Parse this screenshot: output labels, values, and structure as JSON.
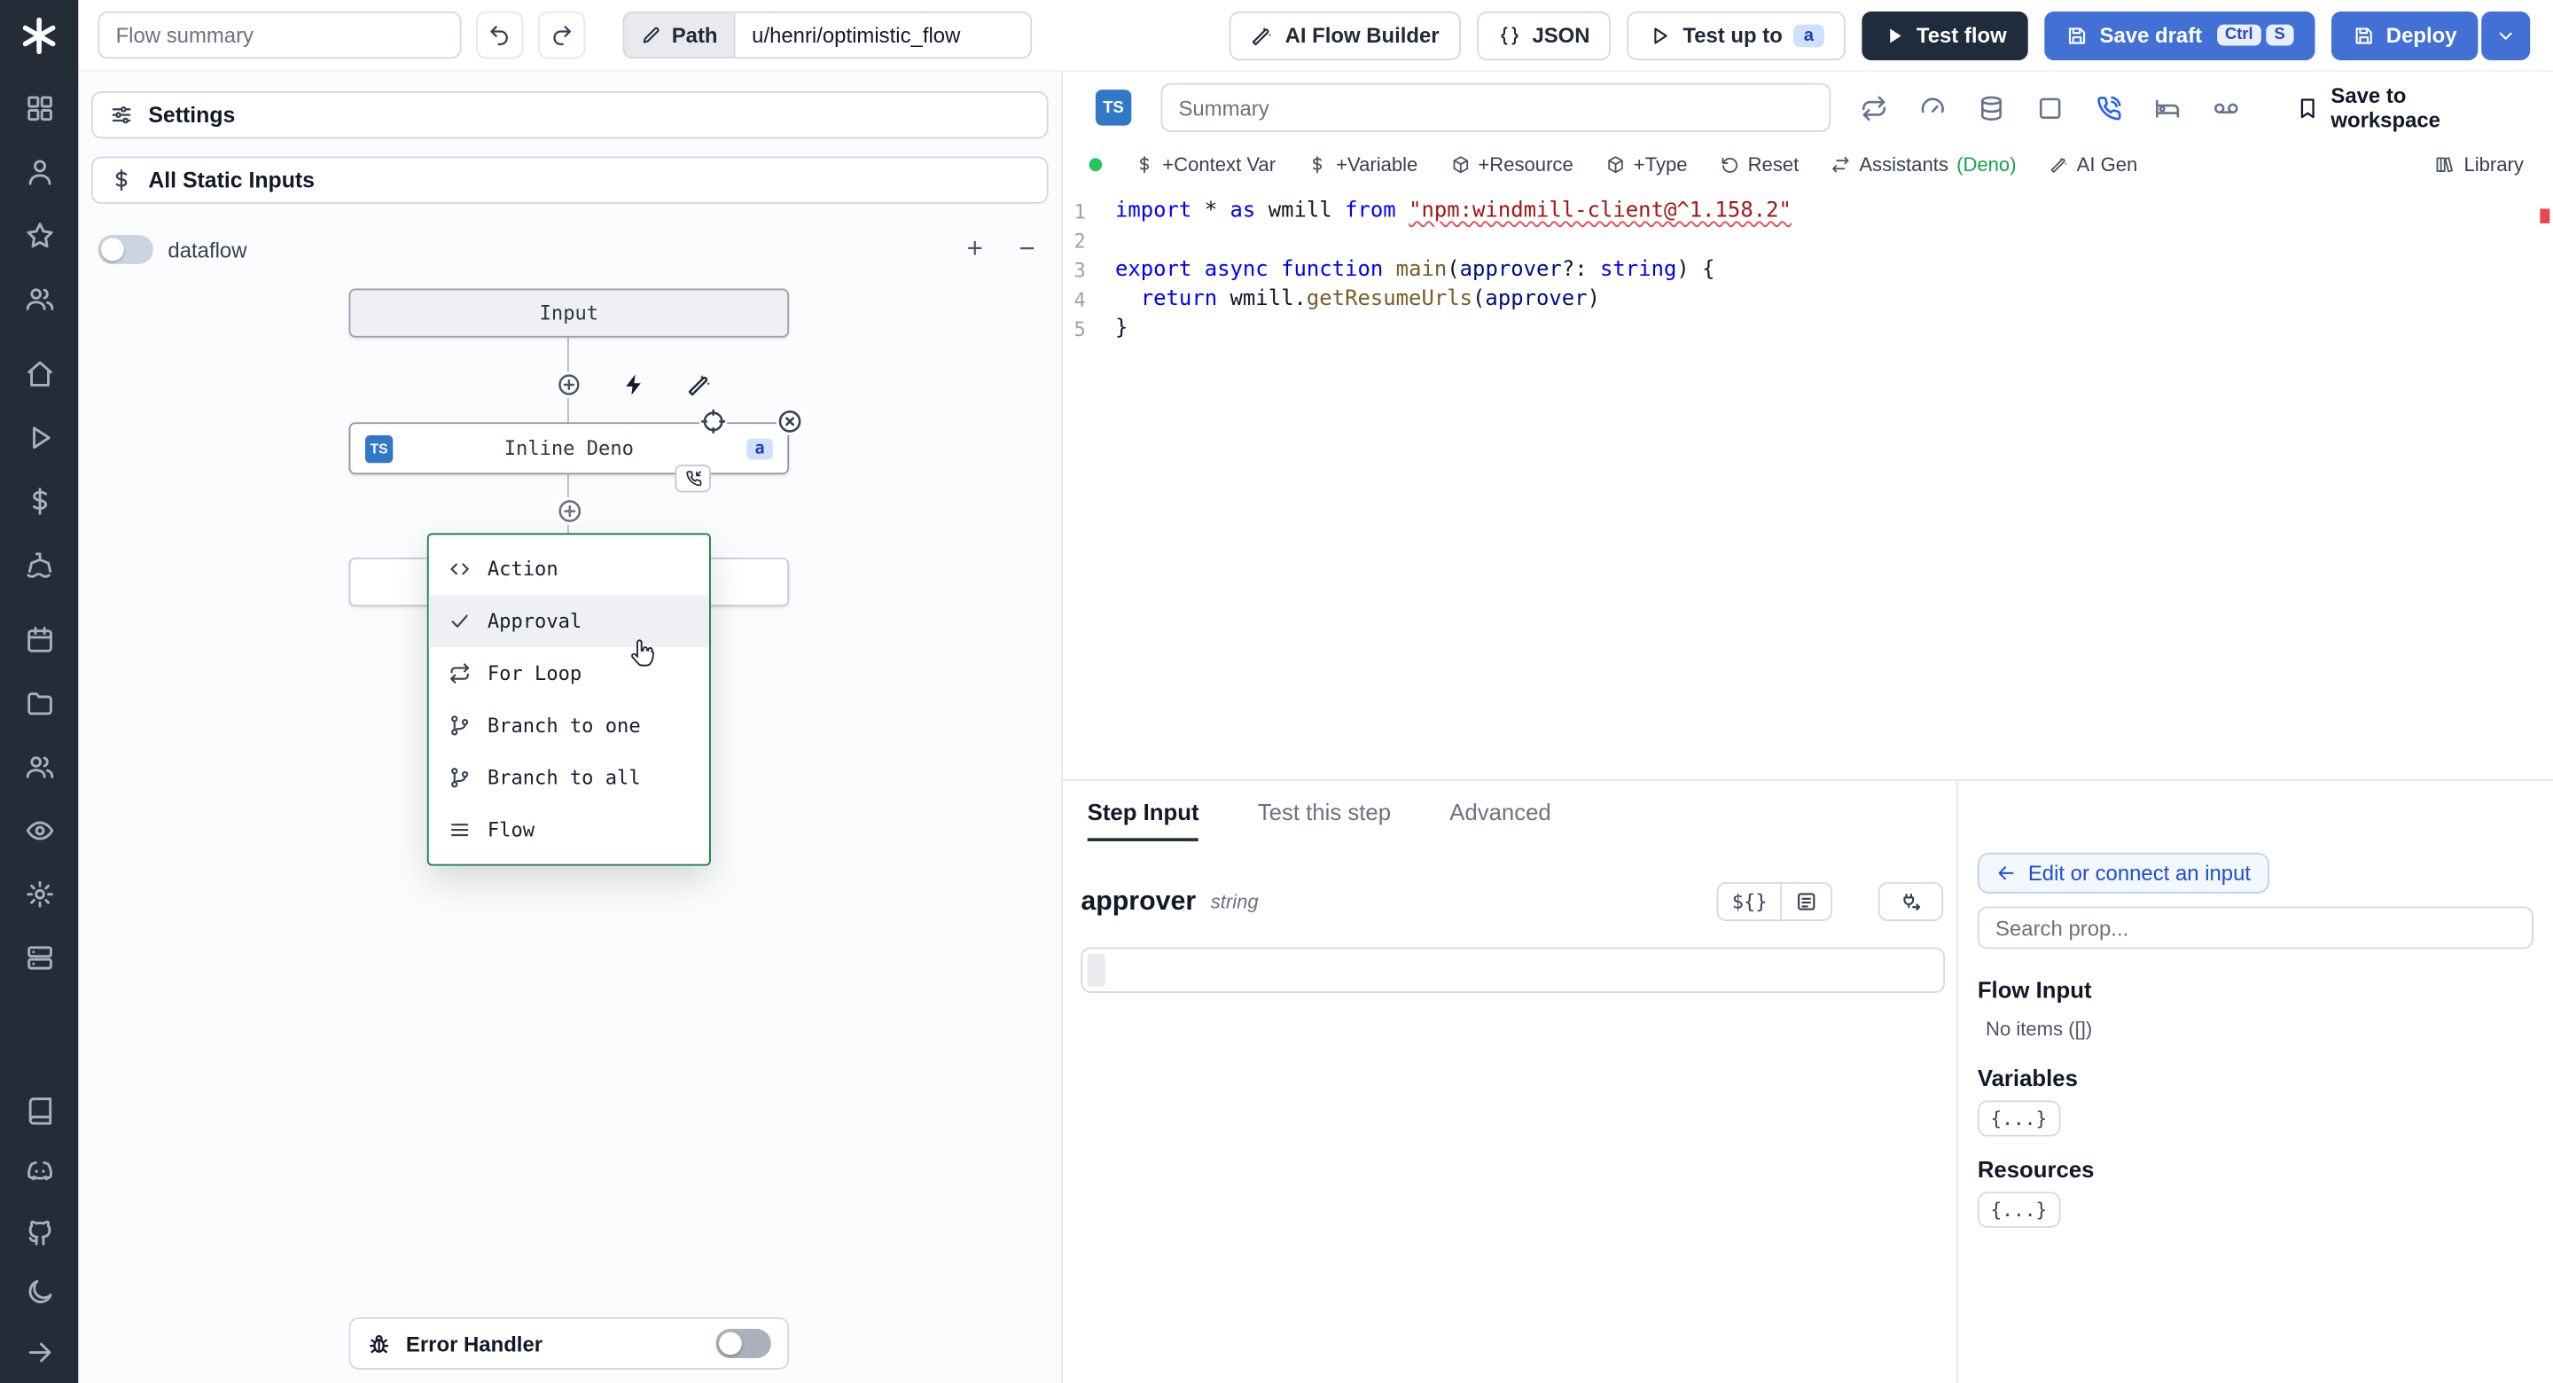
{
  "colors": {
    "primary_blue": "#4270d4",
    "dark_button": "#202b3c",
    "menu_border_green": "#15803d",
    "ts_badge_blue": "#3178c6",
    "step_badge_bg": "#cfe0fc",
    "step_badge_text": "#1e40af",
    "active_icon_blue": "#2563eb",
    "deno_green": "#16a34a",
    "assistant_dot_green": "#22c55e",
    "error_red": "#e5484d"
  },
  "topbar": {
    "flow_summary_placeholder": "Flow summary",
    "path_button": "Path",
    "path_value": "u/henri/optimistic_flow",
    "ai_flow_builder": "AI Flow Builder",
    "json_button": "JSON",
    "test_up_to": "Test up to",
    "test_up_to_badge": "a",
    "test_flow": "Test flow",
    "save_draft": "Save draft",
    "save_draft_kbd": [
      "Ctrl",
      "S"
    ],
    "deploy": "Deploy"
  },
  "rail": {
    "sections": [
      {
        "items": [
          "grid",
          "user",
          "star",
          "users"
        ]
      },
      {
        "items": [
          "home",
          "play",
          "dollar",
          "ship"
        ]
      },
      {
        "items": [
          "calendar",
          "folder",
          "users",
          "eye",
          "gear",
          "worker"
        ]
      },
      {
        "items": [
          "book",
          "discord",
          "github",
          "moon",
          "arrow-right"
        ]
      }
    ]
  },
  "canvas": {
    "settings_label": "Settings",
    "static_inputs_label": "All Static Inputs",
    "dataflow_label": "dataflow",
    "zoom_in": "+",
    "zoom_out": "−",
    "input_node_label": "Input",
    "step_node": {
      "badge": "TS",
      "label": "Inline Deno",
      "suffix_badge": "a"
    },
    "insert_menu": [
      {
        "icon": "code",
        "label": "Action"
      },
      {
        "icon": "check",
        "label": "Approval",
        "hovered": true
      },
      {
        "icon": "repeat",
        "label": "For Loop"
      },
      {
        "icon": "git-branch",
        "label": "Branch to one"
      },
      {
        "icon": "git-branch",
        "label": "Branch to all"
      },
      {
        "icon": "menu",
        "label": "Flow"
      }
    ],
    "error_handler_label": "Error Handler"
  },
  "editor": {
    "lang_badge": "TS",
    "summary_placeholder": "Summary",
    "header_icons": [
      "cycle",
      "gauge",
      "database",
      "square",
      "phone-call",
      "bed",
      "voicemail"
    ],
    "active_header_icon": "phone-call",
    "save_to_workspace": "Save to workspace",
    "toolbar": [
      {
        "icon": "dollar",
        "label": "+Context Var"
      },
      {
        "icon": "dollar",
        "label": "+Variable"
      },
      {
        "icon": "package",
        "label": "+Resource"
      },
      {
        "icon": "package",
        "label": "+Type"
      },
      {
        "icon": "rotate-ccw",
        "label": "Reset"
      },
      {
        "icon": "arrows-lr",
        "label": "Assistants",
        "suffix": "(Deno)"
      },
      {
        "icon": "wand",
        "label": "AI Gen"
      }
    ],
    "library_label": "Library",
    "code": {
      "lines": [
        {
          "n": 1,
          "tokens": [
            {
              "t": "import",
              "c": "kw"
            },
            {
              "t": " * ",
              "c": "p"
            },
            {
              "t": "as",
              "c": "kw"
            },
            {
              "t": " wmill ",
              "c": "p"
            },
            {
              "t": "from",
              "c": "kw"
            },
            {
              "t": " ",
              "c": "p"
            },
            {
              "t": "\"npm:windmill-client@^1.158.2\"",
              "c": "str",
              "squiggle": true
            }
          ]
        },
        {
          "n": 2,
          "tokens": []
        },
        {
          "n": 3,
          "tokens": [
            {
              "t": "export",
              "c": "kw"
            },
            {
              "t": " ",
              "c": "p"
            },
            {
              "t": "async",
              "c": "kw"
            },
            {
              "t": " ",
              "c": "p"
            },
            {
              "t": "function",
              "c": "kw"
            },
            {
              "t": " ",
              "c": "p"
            },
            {
              "t": "main",
              "c": "fn"
            },
            {
              "t": "(",
              "c": "p"
            },
            {
              "t": "approver",
              "c": "param"
            },
            {
              "t": "?: ",
              "c": "p"
            },
            {
              "t": "string",
              "c": "kw"
            },
            {
              "t": ") {",
              "c": "p"
            }
          ]
        },
        {
          "n": 4,
          "tokens": [
            {
              "t": "  ",
              "c": "p"
            },
            {
              "t": "return",
              "c": "kw"
            },
            {
              "t": " wmill.",
              "c": "p"
            },
            {
              "t": "getResumeUrls",
              "c": "fn"
            },
            {
              "t": "(",
              "c": "p"
            },
            {
              "t": "approver",
              "c": "param"
            },
            {
              "t": ")",
              "c": "p"
            }
          ]
        },
        {
          "n": 5,
          "tokens": [
            {
              "t": "}",
              "c": "p"
            }
          ]
        }
      ]
    }
  },
  "step_panel": {
    "tabs": [
      {
        "label": "Step Input",
        "active": true
      },
      {
        "label": "Test this step"
      },
      {
        "label": "Advanced"
      }
    ],
    "field": {
      "name": "approver",
      "type": "string",
      "value": ""
    },
    "expr_button": "${}",
    "props": {
      "edit_connect": "Edit or connect an input",
      "search_placeholder": "Search prop...",
      "flow_input_title": "Flow Input",
      "flow_input_empty": "No items ([])",
      "variables_title": "Variables",
      "variables_button": "{...}",
      "resources_title": "Resources",
      "resources_button": "{...}"
    }
  }
}
